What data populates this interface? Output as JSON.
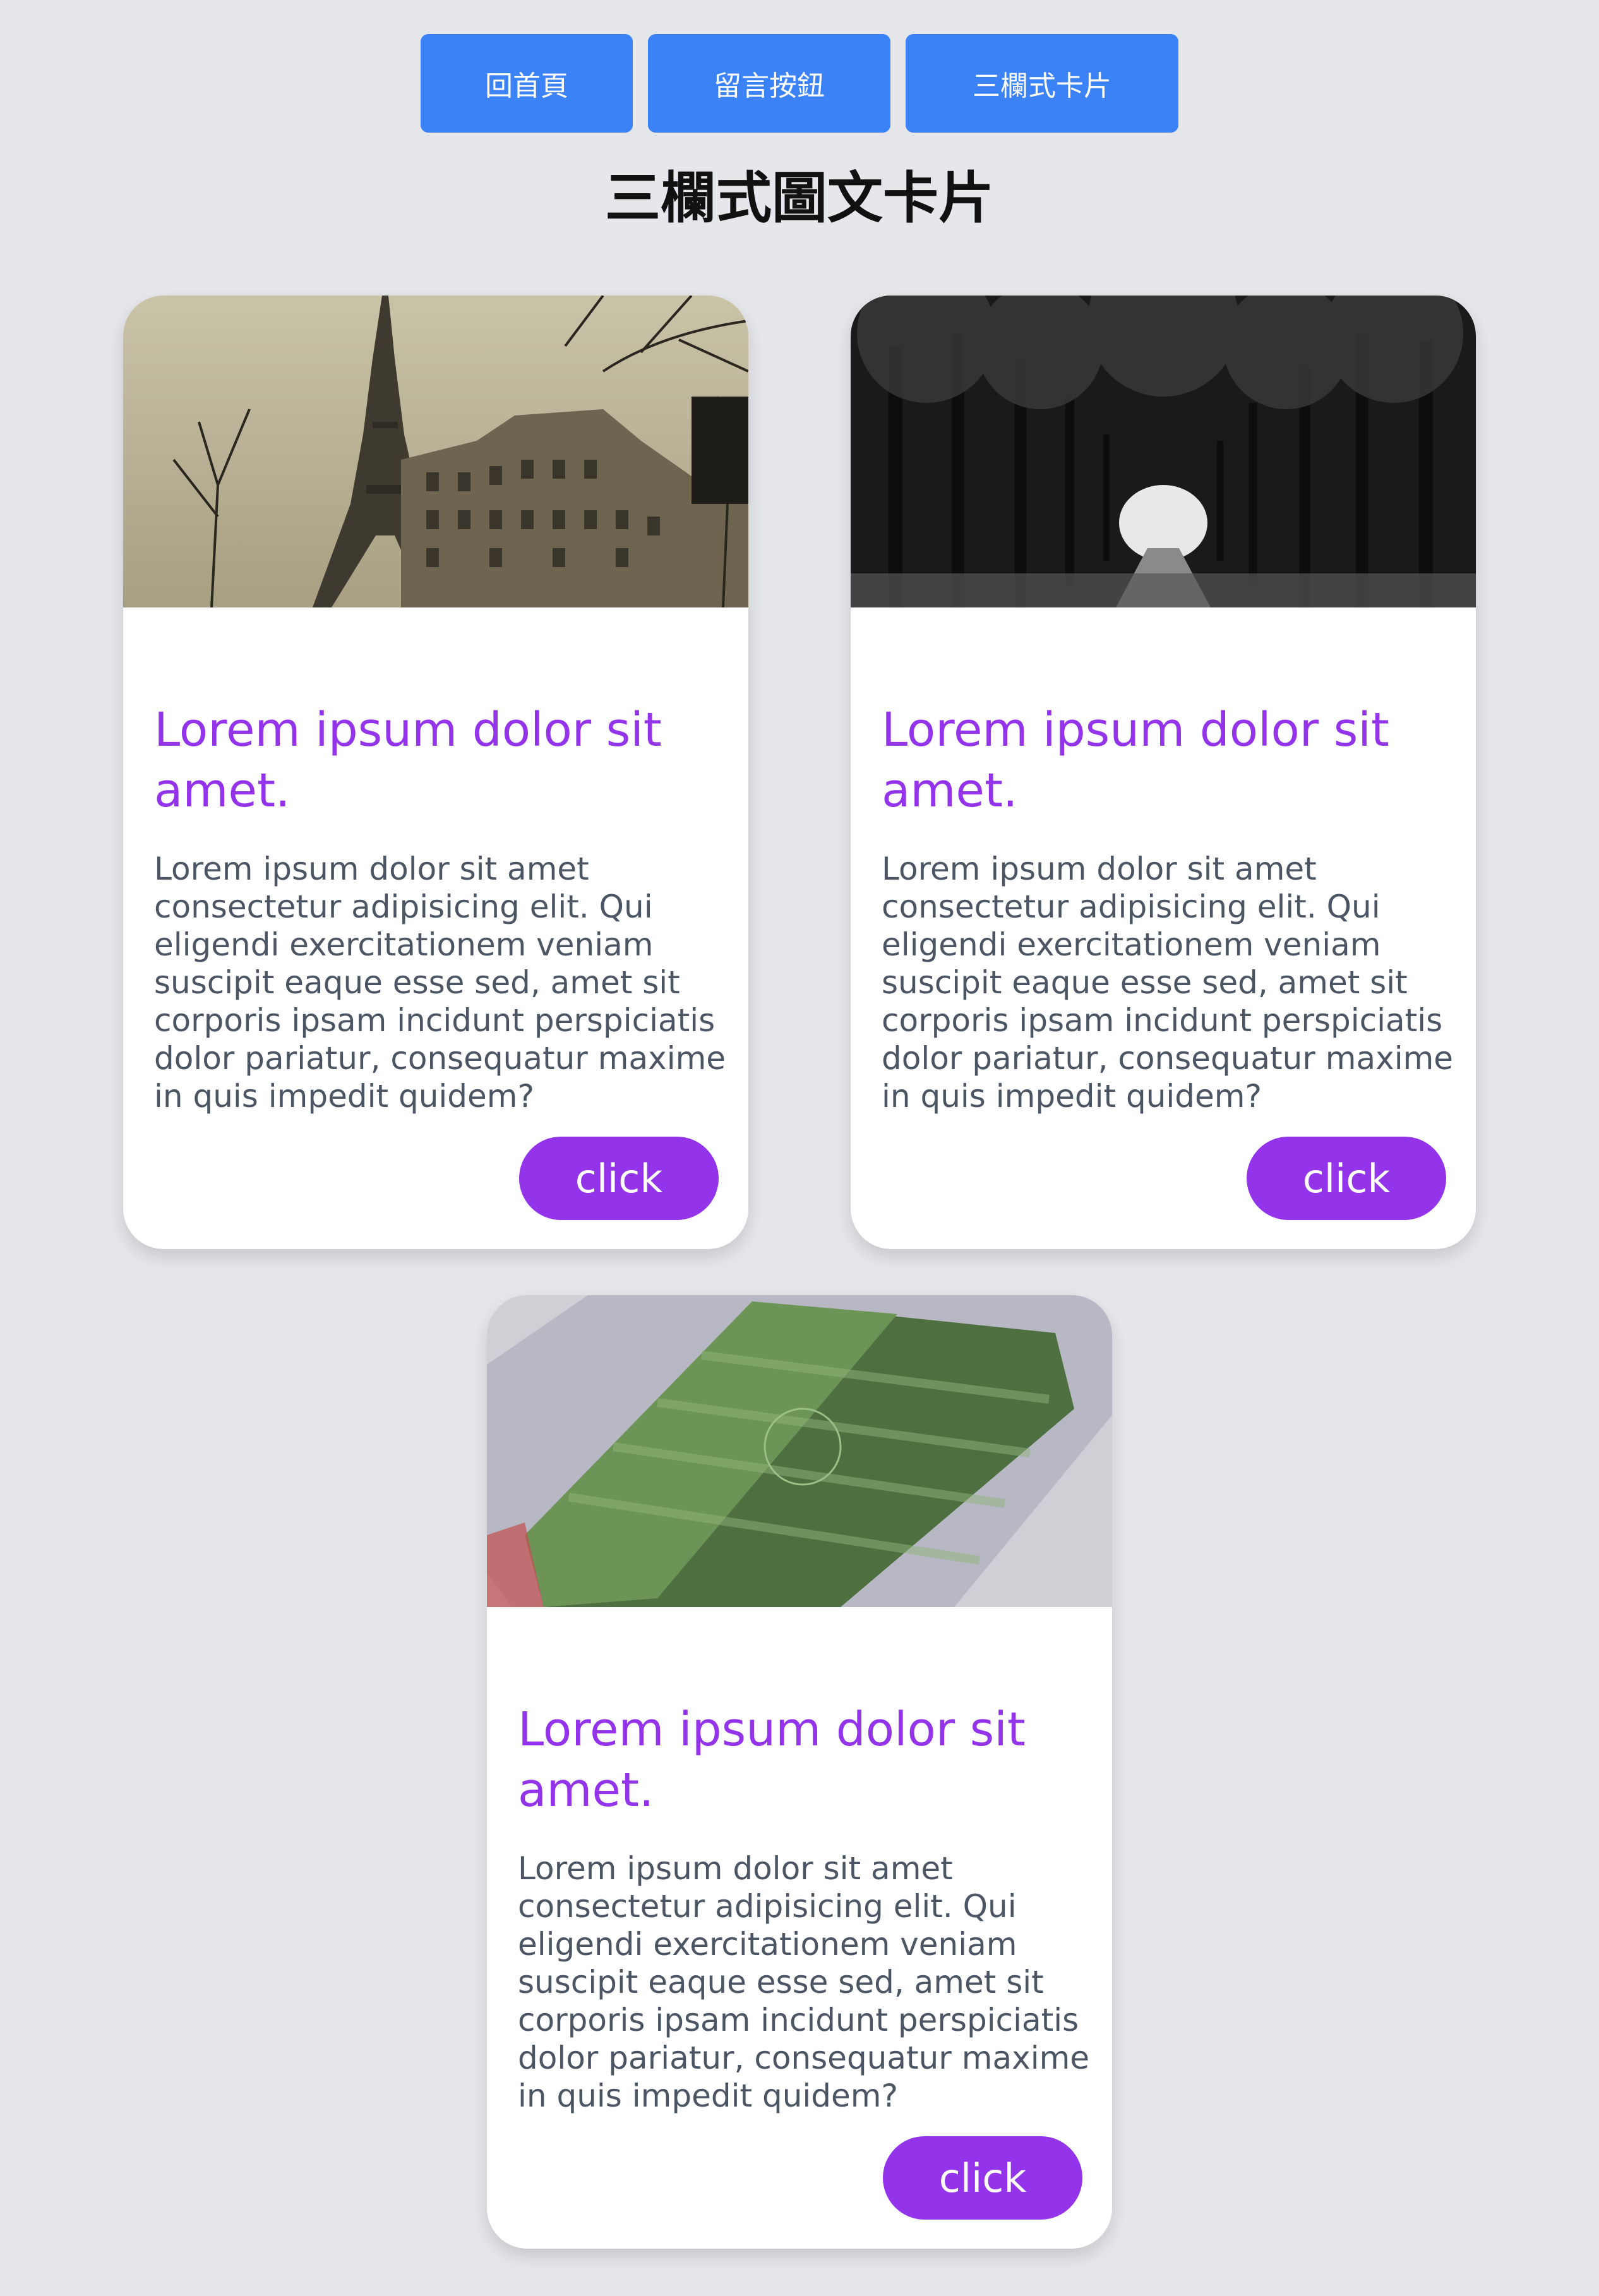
{
  "nav": {
    "home_label": "回首頁",
    "comment_label": "留言按鈕",
    "three_col_label": "三欄式卡片"
  },
  "page_title": "三欄式圖文卡片",
  "cards": [
    {
      "image": "eiffel-tower-street-photo",
      "title": "Lorem ipsum dolor sit amet.",
      "text": "Lorem ipsum dolor sit amet consectetur adipisicing elit. Qui eligendi exercitationem veniam suscipit eaque esse sed, amet sit corporis ipsam incidunt perspiciatis dolor pariatur, consequatur maxime in quis impedit quidem?",
      "button_label": "click"
    },
    {
      "image": "tree-lined-road-photo",
      "title": "Lorem ipsum dolor sit amet.",
      "text": "Lorem ipsum dolor sit amet consectetur adipisicing elit. Qui eligendi exercitationem veniam suscipit eaque esse sed, amet sit corporis ipsam incidunt perspiciatis dolor pariatur, consequatur maxime in quis impedit quidem?",
      "button_label": "click"
    },
    {
      "image": "stadium-aerial-photo",
      "title": "Lorem ipsum dolor sit amet.",
      "text": "Lorem ipsum dolor sit amet consectetur adipisicing elit. Qui eligendi exercitationem veniam suscipit eaque esse sed, amet sit corporis ipsam incidunt perspiciatis dolor pariatur, consequatur maxime in quis impedit quidem?",
      "button_label": "click"
    }
  ],
  "colors": {
    "background": "#e5e7eb",
    "nav_button": "#3b82f6",
    "accent": "#9333ea",
    "body_text": "#4b5563"
  }
}
